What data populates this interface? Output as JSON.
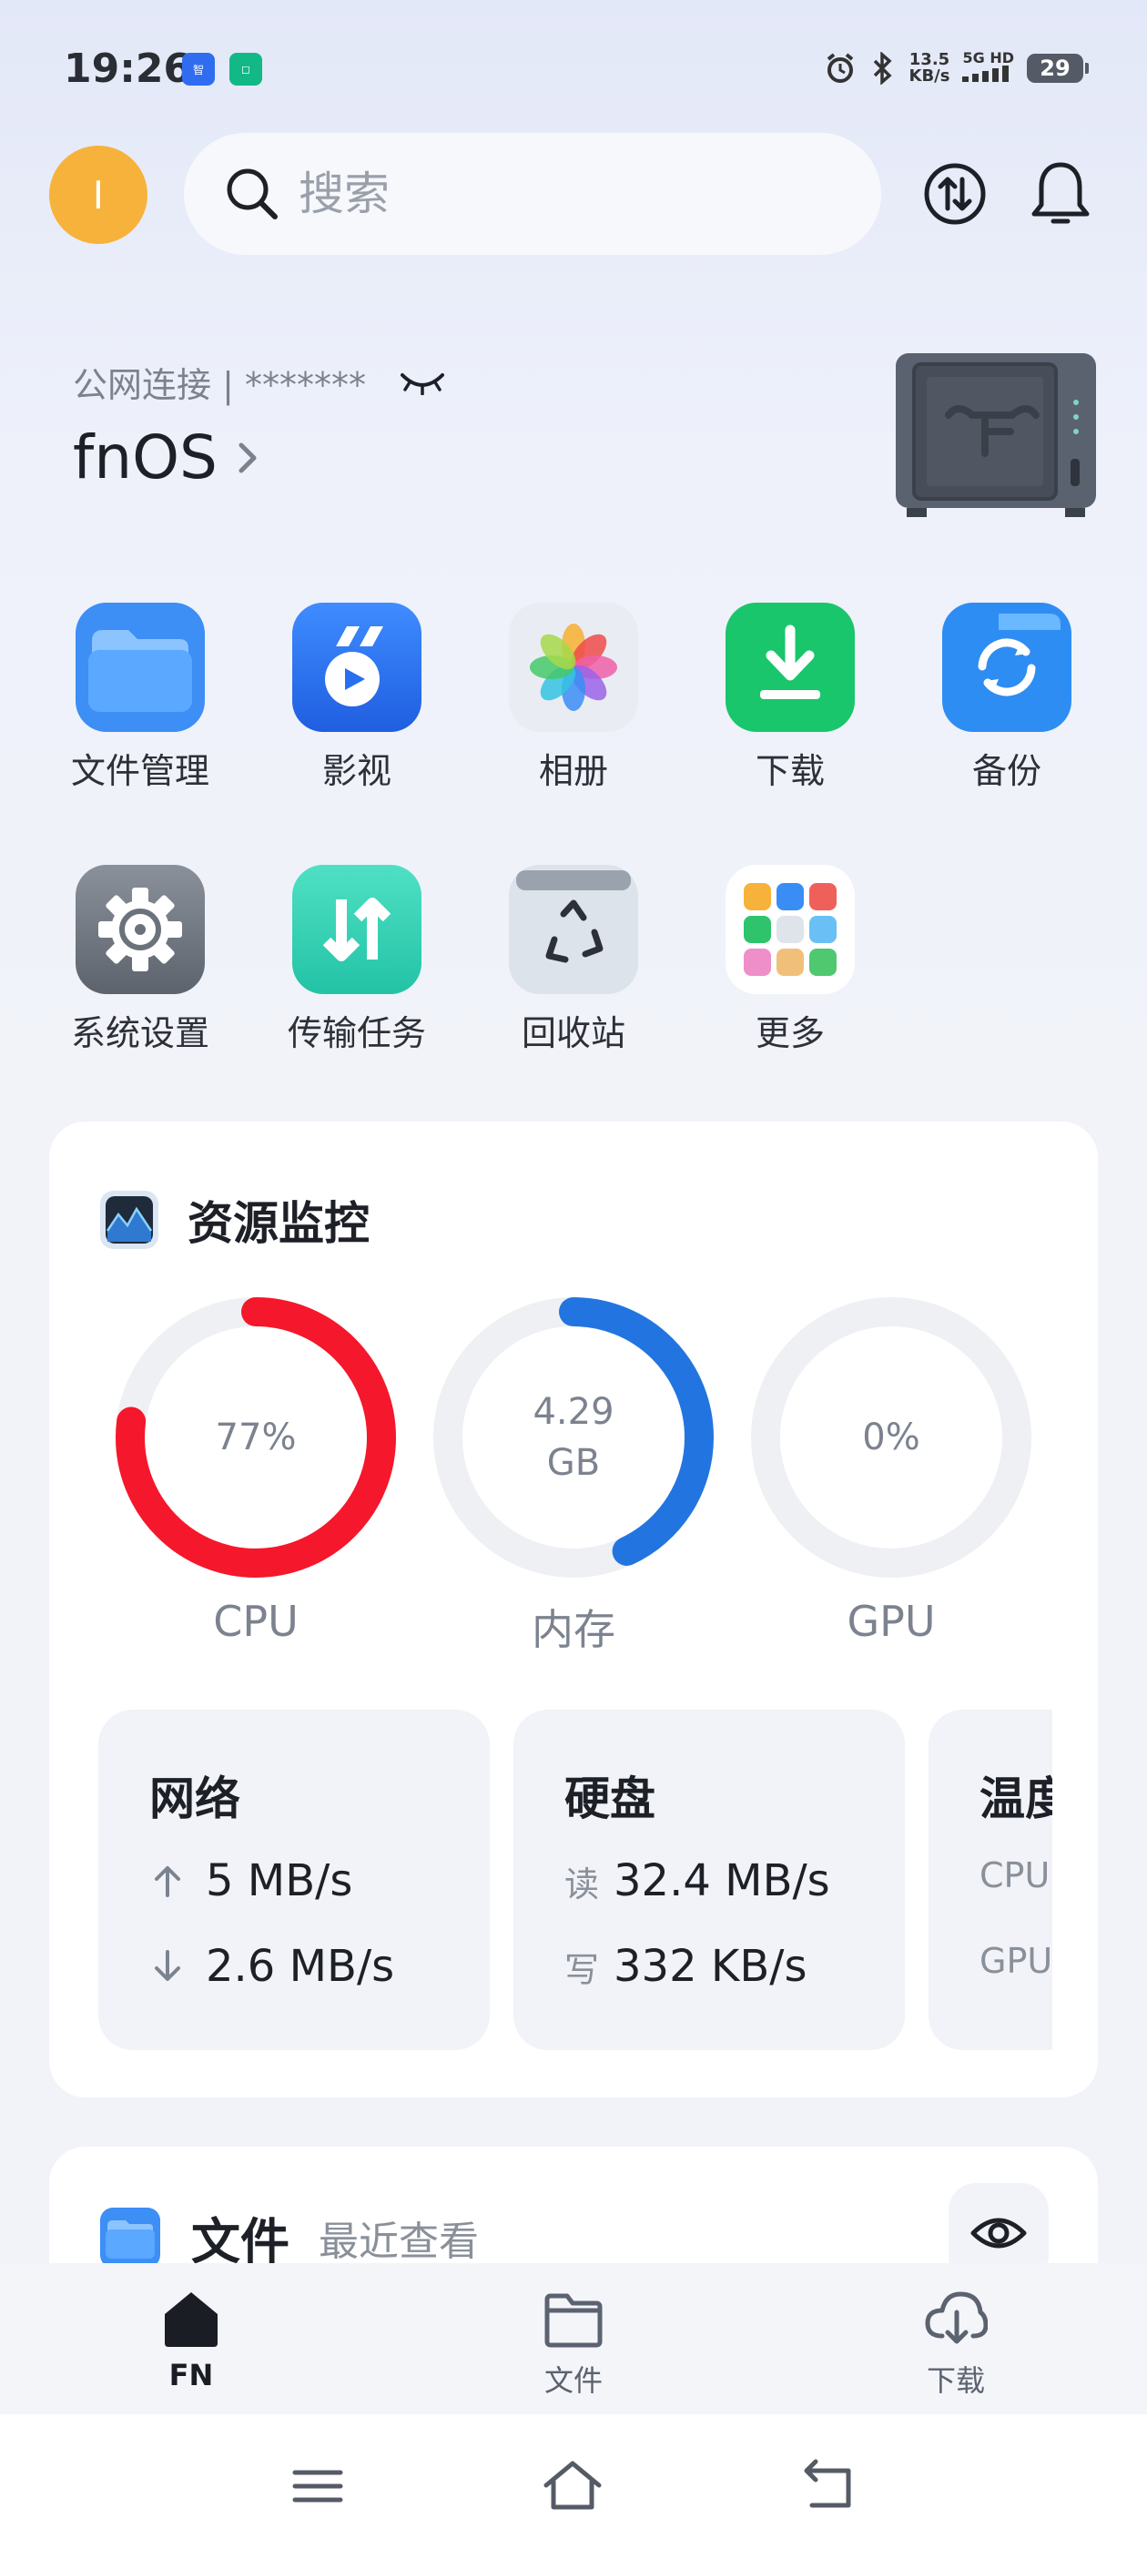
{
  "status_bar": {
    "time": "19:26",
    "notif_icons": [
      "zhijia-app-icon",
      "mijia-app-icon"
    ],
    "net_speed_value": "13.5",
    "net_speed_unit": "KB/s",
    "network": "5G HD",
    "battery": "29"
  },
  "header": {
    "avatar_letter": "I",
    "search_placeholder": "搜索",
    "transfer_icon": "transfer-icon",
    "bell_icon": "bell-icon"
  },
  "server": {
    "connection": "公网连接 | *******",
    "name": "fnOS"
  },
  "apps": [
    {
      "label": "文件管理",
      "icon": "folder-icon"
    },
    {
      "label": "影视",
      "icon": "video-icon"
    },
    {
      "label": "相册",
      "icon": "photos-icon"
    },
    {
      "label": "下载",
      "icon": "download-icon"
    },
    {
      "label": "备份",
      "icon": "backup-icon"
    },
    {
      "label": "系统设置",
      "icon": "settings-icon"
    },
    {
      "label": "传输任务",
      "icon": "transfer-tasks-icon"
    },
    {
      "label": "回收站",
      "icon": "recycle-bin-icon"
    },
    {
      "label": "更多",
      "icon": "more-apps-icon"
    }
  ],
  "monitor": {
    "title": "资源监控",
    "gauges": [
      {
        "label": "CPU",
        "value_line1": "77%",
        "value_line2": "",
        "fraction": 0.77,
        "color": "#f5172b"
      },
      {
        "label": "内存",
        "value_line1": "4.29",
        "value_line2": "GB",
        "fraction": 0.43,
        "color": "#2275e0"
      },
      {
        "label": "GPU",
        "value_line1": "0%",
        "value_line2": "",
        "fraction": 0.0,
        "color": "#2275e0"
      }
    ],
    "network": {
      "title": "网络",
      "up": "5 MB/s",
      "down": "2.6 MB/s"
    },
    "disk": {
      "title": "硬盘",
      "read_label": "读",
      "read": "32.4 MB/s",
      "write_label": "写",
      "write": "332 KB/s"
    },
    "temp": {
      "title": "温度",
      "cpu_label": "CPU",
      "gpu_label": "GPU"
    }
  },
  "files": {
    "title": "文件",
    "subtitle": "最近查看"
  },
  "bottom_nav": [
    {
      "label": "FN",
      "icon": "home-icon",
      "active": true
    },
    {
      "label": "文件",
      "icon": "folder-outline-icon",
      "active": false
    },
    {
      "label": "下载",
      "icon": "cloud-download-icon",
      "active": false
    }
  ],
  "system_nav": [
    "menu-icon",
    "home-outline-icon",
    "back-icon"
  ]
}
